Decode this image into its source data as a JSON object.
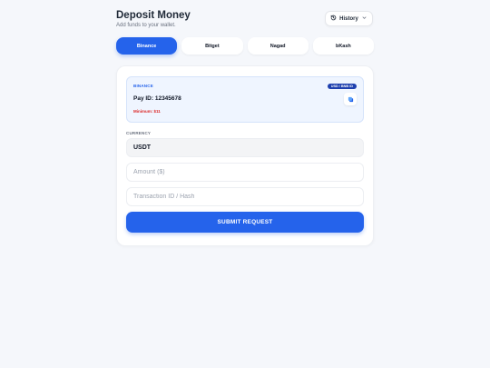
{
  "header": {
    "title": "Deposit Money",
    "subtitle": "Add funds to your wallet.",
    "history_label": "History"
  },
  "tabs": [
    {
      "label": "Binance",
      "active": true
    },
    {
      "label": "Bitget",
      "active": false
    },
    {
      "label": "Nagad",
      "active": false
    },
    {
      "label": "bKash",
      "active": false
    }
  ],
  "info": {
    "label": "BINANCE",
    "badge": "USD / BNB ID",
    "pay_id": "Pay ID: 12345678",
    "minimum": "Minimum: $11"
  },
  "form": {
    "currency_label": "CURRENCY",
    "currency_value": "USDT",
    "amount_placeholder": "Amount ($)",
    "txid_placeholder": "Transaction ID / Hash",
    "submit_label": "SUBMIT REQUEST"
  },
  "colors": {
    "accent": "#2563eb",
    "warning": "#dc2626",
    "background": "#f5f7fb"
  },
  "icons": {
    "history": "history-icon",
    "chevron": "chevron-down-icon",
    "copy": "copy-icon"
  }
}
